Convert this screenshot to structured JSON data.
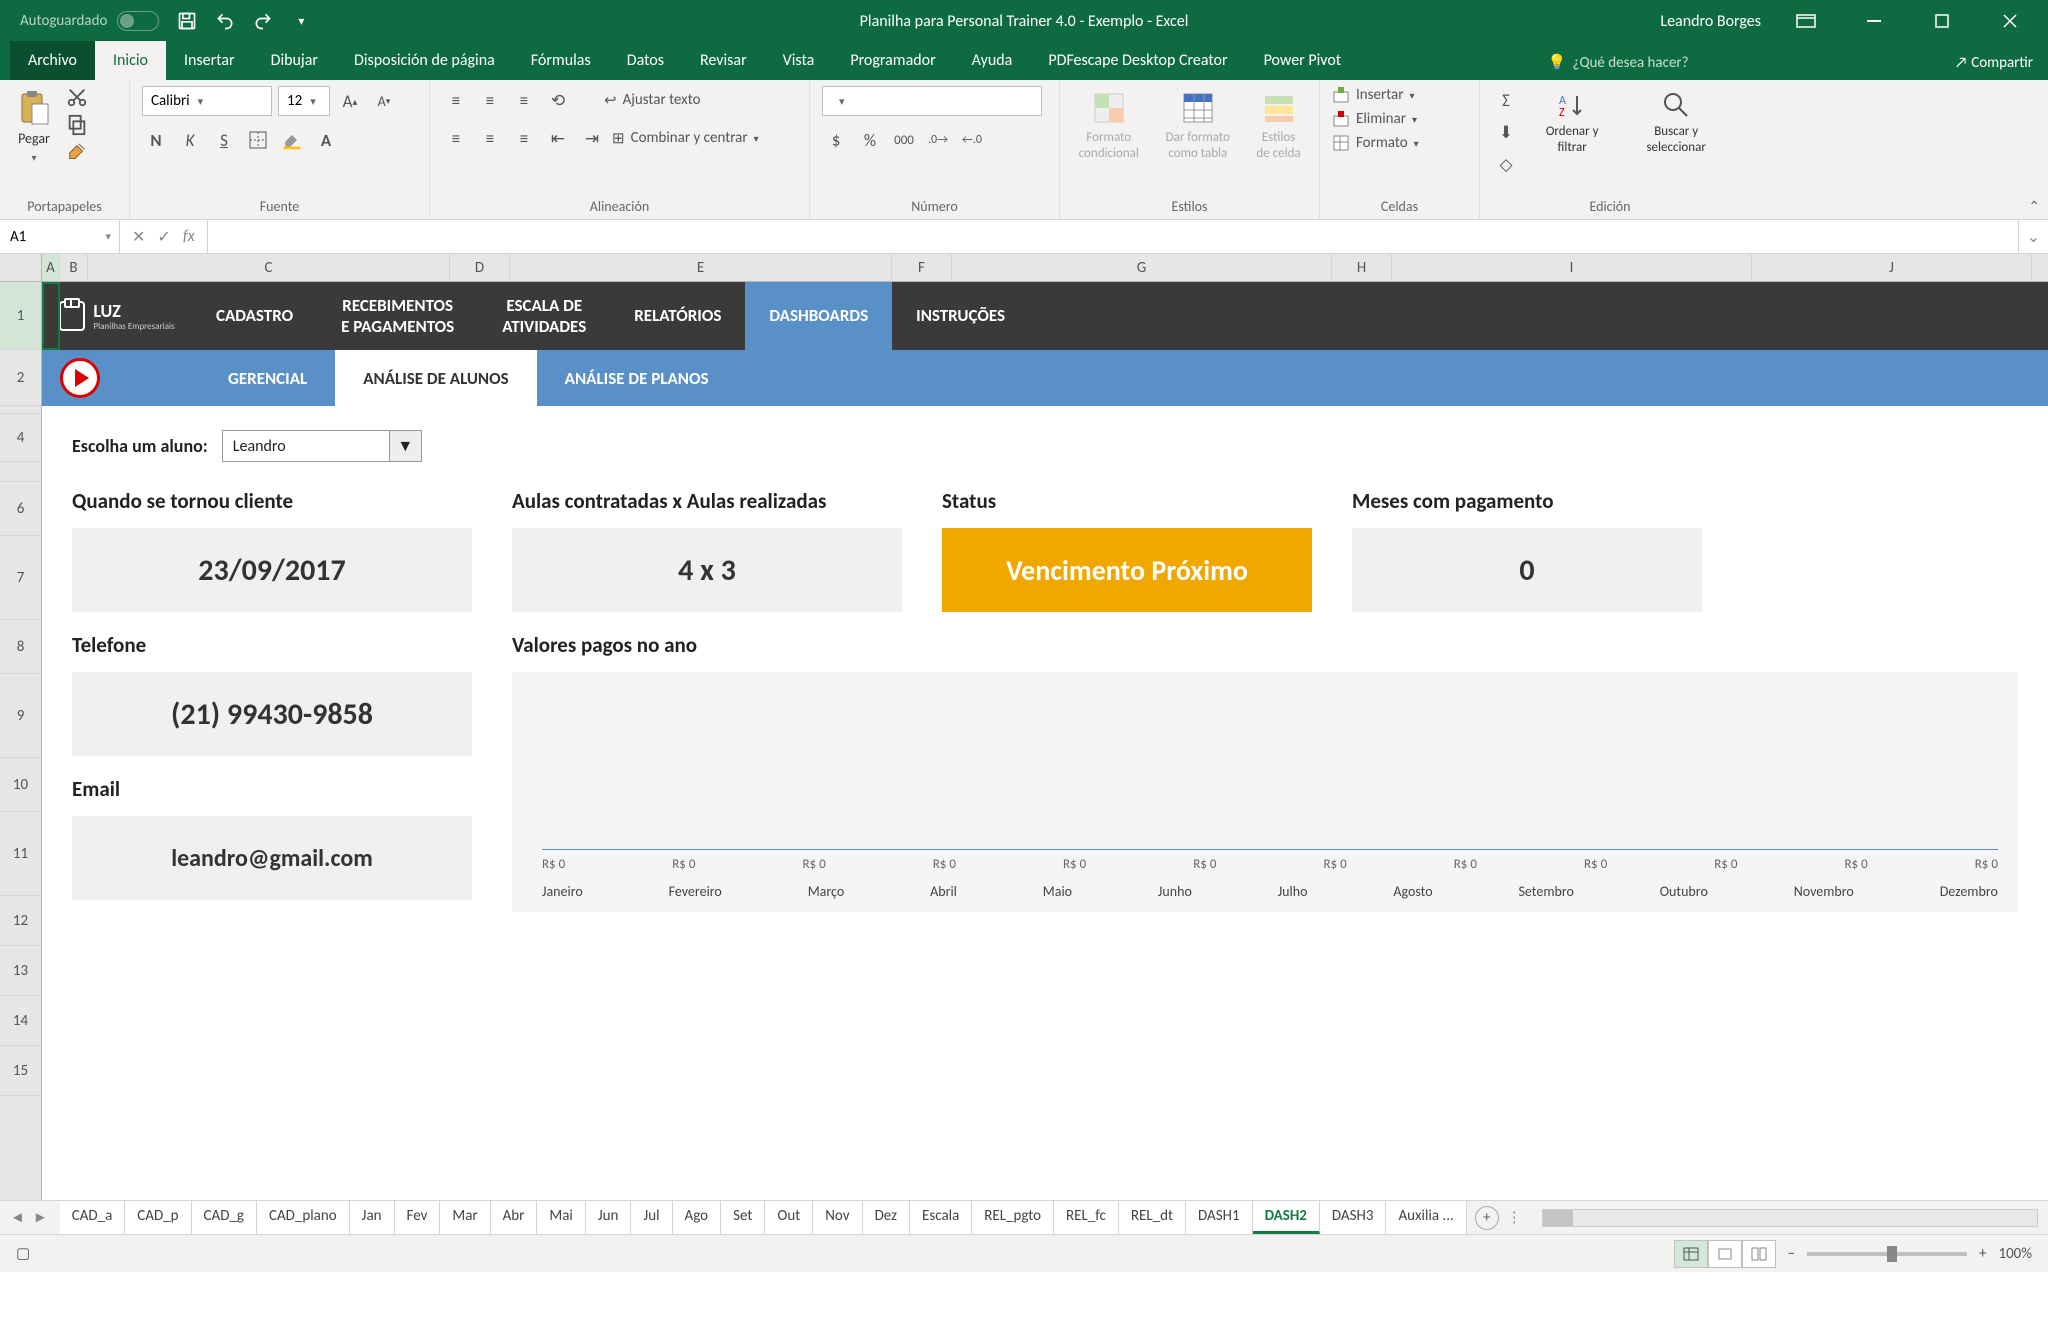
{
  "title_bar": {
    "autosave": "Autoguardado",
    "title": "Planilha para Personal Trainer 4.0 -  Exemplo  -  Excel",
    "user": "Leandro Borges"
  },
  "menu": {
    "file": "Archivo",
    "home": "Inicio",
    "insert": "Insertar",
    "draw": "Dibujar",
    "layout": "Disposición de página",
    "formulas": "Fórmulas",
    "data": "Datos",
    "review": "Revisar",
    "view": "Vista",
    "developer": "Programador",
    "help": "Ayuda",
    "pdf": "PDFescape Desktop Creator",
    "powerpivot": "Power Pivot",
    "search": "¿Qué desea hacer?",
    "share": "Compartir"
  },
  "ribbon": {
    "paste": "Pegar",
    "clipboard": "Portapapeles",
    "font_name": "Calibri",
    "font_size": "12",
    "font": "Fuente",
    "wrap": "Ajustar texto",
    "merge": "Combinar y centrar",
    "alignment": "Alineación",
    "number": "Número",
    "cond_format": "Formato condicional",
    "as_table": "Dar formato como tabla",
    "cell_styles": "Estilos de celda",
    "styles": "Estilos",
    "insert_c": "Insertar",
    "delete_c": "Eliminar",
    "format_c": "Formato",
    "cells": "Celdas",
    "sort": "Ordenar y filtrar",
    "find": "Buscar y seleccionar",
    "editing": "Edición"
  },
  "formula_bar": {
    "cell": "A1",
    "fx": "fx"
  },
  "columns": [
    "A",
    "B",
    "C",
    "D",
    "E",
    "F",
    "G",
    "H",
    "I",
    "J"
  ],
  "rows": [
    "1",
    "2",
    "",
    "4",
    "",
    "6",
    "7",
    "8",
    "9",
    "10",
    "11",
    "12",
    "13",
    "14",
    "15"
  ],
  "sheet_nav": {
    "logo": "LUZ",
    "logo_sub": "Planilhas Empresariais",
    "items": [
      "CADASTRO",
      "RECEBIMENTOS E PAGAMENTOS",
      "ESCALA DE ATIVIDADES",
      "RELATÓRIOS",
      "DASHBOARDS",
      "INSTRUÇÕES"
    ],
    "sub": [
      "GERENCIAL",
      "ANÁLISE DE ALUNOS",
      "ANÁLISE DE PLANOS"
    ]
  },
  "content": {
    "select_label": "Escolha um aluno:",
    "select_value": "Leandro",
    "client_since_label": "Quando se tornou cliente",
    "client_since_value": "23/09/2017",
    "classes_label": "Aulas contratadas x Aulas realizadas",
    "classes_value": "4 x 3",
    "status_label": "Status",
    "status_value": "Vencimento Próximo",
    "months_paid_label": "Meses com pagamento",
    "months_paid_value": "0",
    "phone_label": "Telefone",
    "phone_value": "(21) 99430-9858",
    "values_label": "Valores pagos no ano",
    "email_label": "Email",
    "email_value": "leandro@gmail.com"
  },
  "chart_data": {
    "type": "line",
    "title": "Valores pagos no ano",
    "xlabel": "",
    "ylabel": "",
    "categories": [
      "Janeiro",
      "Fevereiro",
      "Março",
      "Abril",
      "Maio",
      "Junho",
      "Julho",
      "Agosto",
      "Setembro",
      "Outubro",
      "Novembro",
      "Dezembro"
    ],
    "values": [
      0,
      0,
      0,
      0,
      0,
      0,
      0,
      0,
      0,
      0,
      0,
      0
    ],
    "value_labels": [
      "R$ 0",
      "R$ 0",
      "R$ 0",
      "R$ 0",
      "R$ 0",
      "R$ 0",
      "R$ 0",
      "R$ 0",
      "R$ 0",
      "R$ 0",
      "R$ 0",
      "R$ 0"
    ],
    "ylim": [
      0,
      1
    ]
  },
  "sheet_tabs": [
    "CAD_a",
    "CAD_p",
    "CAD_g",
    "CAD_plano",
    "Jan",
    "Fev",
    "Mar",
    "Abr",
    "Mai",
    "Jun",
    "Jul",
    "Ago",
    "Set",
    "Out",
    "Nov",
    "Dez",
    "Escala",
    "REL_pgto",
    "REL_fc",
    "REL_dt",
    "DASH1",
    "DASH2",
    "DASH3",
    "Auxilia ..."
  ],
  "active_sheet": "DASH2",
  "status": {
    "zoom": "100%"
  }
}
